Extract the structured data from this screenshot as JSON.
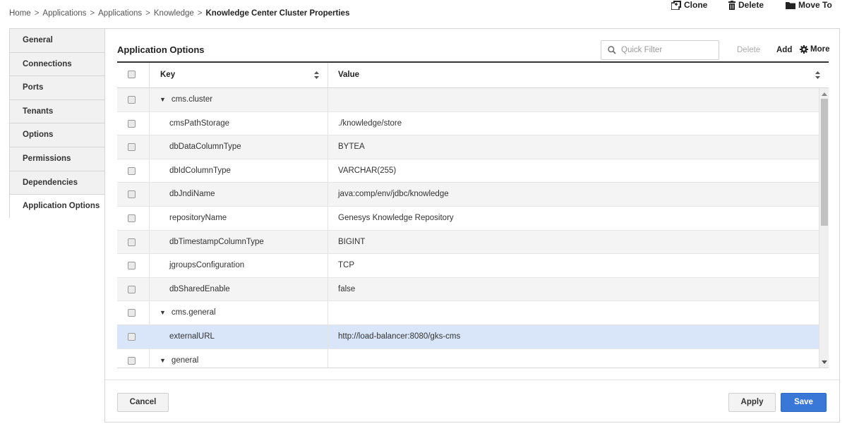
{
  "breadcrumb": {
    "items": [
      "Home",
      "Applications",
      "Applications",
      "Knowledge"
    ],
    "separator": ">",
    "current": "Knowledge Center Cluster Properties"
  },
  "top_actions": {
    "clone": "Clone",
    "delete": "Delete",
    "move_to": "Move To"
  },
  "sidebar": {
    "items": [
      {
        "label": "General"
      },
      {
        "label": "Connections"
      },
      {
        "label": "Ports"
      },
      {
        "label": "Tenants"
      },
      {
        "label": "Options"
      },
      {
        "label": "Permissions"
      },
      {
        "label": "Dependencies"
      },
      {
        "label": "Application Options",
        "active": true
      }
    ]
  },
  "panel": {
    "title": "Application Options",
    "filter_placeholder": "Quick Filter",
    "delete_label": "Delete",
    "add_label": "Add",
    "more_label": "More"
  },
  "grid": {
    "columns": {
      "key": "Key",
      "value": "Value"
    },
    "rows": [
      {
        "key": "cms.cluster",
        "value": "",
        "group": true
      },
      {
        "key": "cmsPathStorage",
        "value": "./knowledge/store"
      },
      {
        "key": "dbDataColumnType",
        "value": "BYTEA"
      },
      {
        "key": "dbIdColumnType",
        "value": "VARCHAR(255)"
      },
      {
        "key": "dbJndiName",
        "value": "java:comp/env/jdbc/knowledge"
      },
      {
        "key": "repositoryName",
        "value": "Genesys Knowledge Repository"
      },
      {
        "key": "dbTimestampColumnType",
        "value": "BIGINT"
      },
      {
        "key": "jgroupsConfiguration",
        "value": "TCP"
      },
      {
        "key": "dbSharedEnable",
        "value": "false"
      },
      {
        "key": "cms.general",
        "value": "",
        "group": true
      },
      {
        "key": "externalURL",
        "value": "http://load-balancer:8080/gks-cms",
        "selected": true
      },
      {
        "key": "general",
        "value": "",
        "group": true
      }
    ]
  },
  "footer": {
    "cancel": "Cancel",
    "apply": "Apply",
    "save": "Save"
  },
  "colors": {
    "accent": "#3a78d8",
    "selected_row": "#d9e6f9",
    "stripe": "#f4f4f4"
  }
}
